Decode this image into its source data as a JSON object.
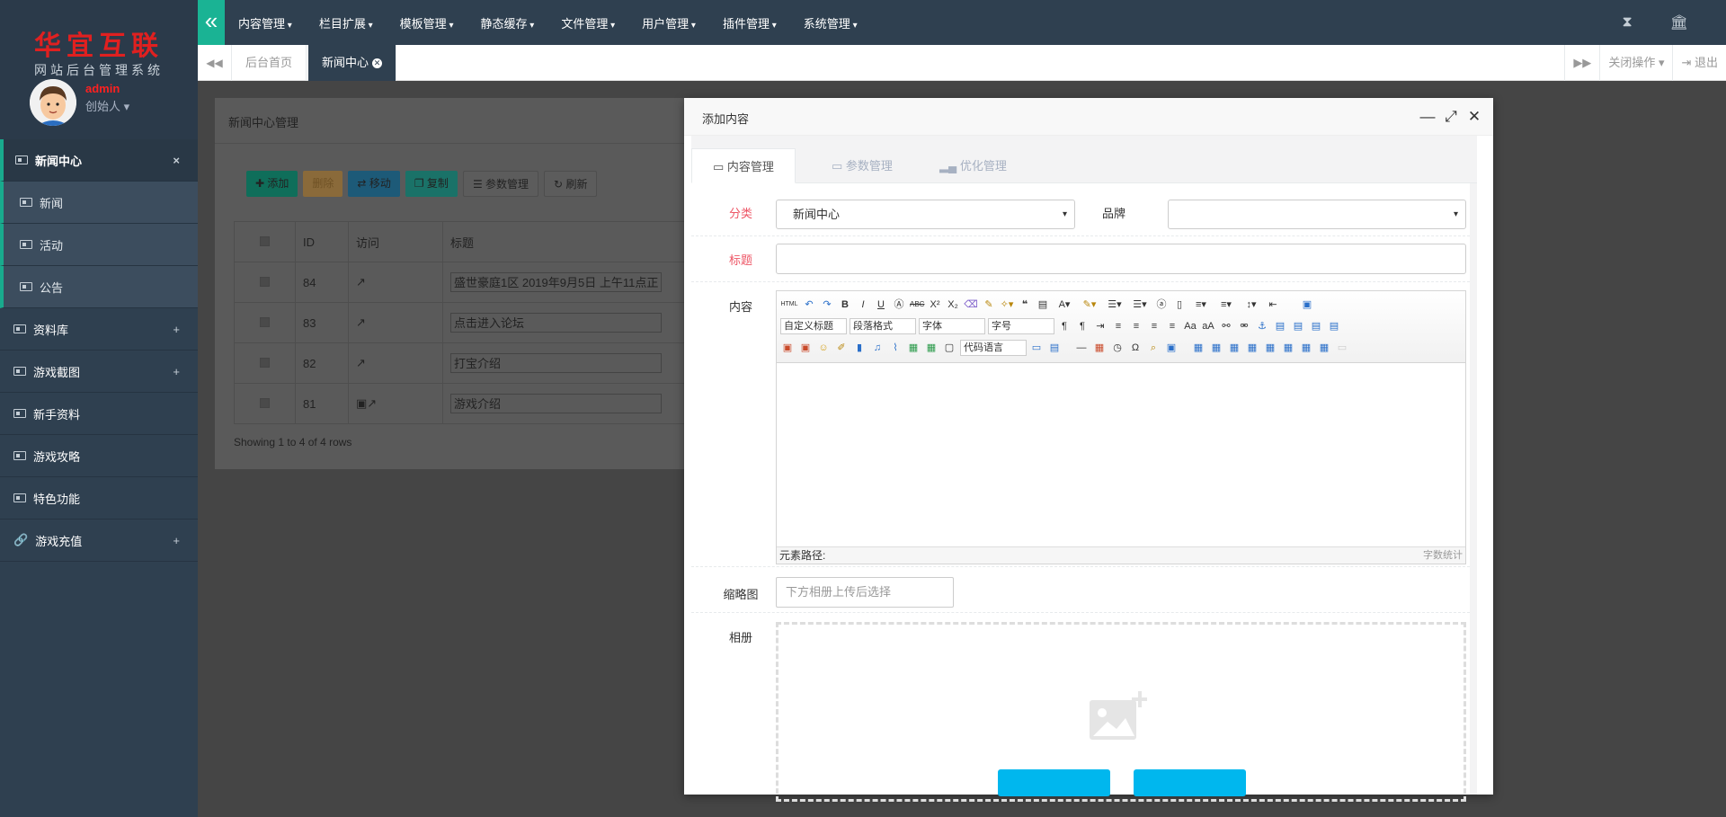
{
  "brand": {
    "title": "华宜互联",
    "subtitle": "网站后台管理系统"
  },
  "user": {
    "name": "admin",
    "role": "创始人"
  },
  "sidebar": {
    "items": [
      {
        "label": "新闻中心",
        "close": "×"
      },
      {
        "label": "新闻"
      },
      {
        "label": "活动"
      },
      {
        "label": "公告"
      },
      {
        "label": "资料库",
        "expand": "+"
      },
      {
        "label": "游戏截图",
        "expand": "+"
      },
      {
        "label": "新手资料"
      },
      {
        "label": "游戏攻略"
      },
      {
        "label": "特色功能"
      },
      {
        "label": "游戏充值",
        "expand": "+"
      }
    ]
  },
  "topnav": [
    "内容管理",
    "栏目扩展",
    "模板管理",
    "静态缓存",
    "文件管理",
    "用户管理",
    "插件管理",
    "系统管理"
  ],
  "tabs": {
    "home": "后台首页",
    "active": "新闻中心",
    "close_ops": "关闭操作",
    "logout": "退出"
  },
  "panel": {
    "title": "新闻中心管理",
    "buttons": [
      "添加",
      "删除",
      "移动",
      "复制",
      "参数管理",
      "刷新"
    ],
    "columns": [
      "ID",
      "访问",
      "标题"
    ],
    "rows": [
      {
        "id": "84",
        "title": "盛世豪庭1区  2019年9月5日 上午11点正"
      },
      {
        "id": "83",
        "title": "点击进入论坛"
      },
      {
        "id": "82",
        "title": "打宝介绍"
      },
      {
        "id": "81",
        "title": "游戏介绍"
      }
    ],
    "showing": "Showing 1 to 4 of 4 rows"
  },
  "modal": {
    "title": "添加内容",
    "tabs": [
      "内容管理",
      "参数管理",
      "优化管理"
    ],
    "fields": {
      "category_label": "分类",
      "category_value": "新闻中心",
      "brand_label": "品牌",
      "title_label": "标题",
      "content_label": "内容",
      "thumb_label": "缩略图",
      "thumb_placeholder": "下方相册上传后选择",
      "album_label": "相册"
    },
    "editor": {
      "selects": [
        "自定义标题",
        "段落格式",
        "字体",
        "字号",
        "代码语言"
      ],
      "path_label": "元素路径:",
      "word_count": "字数统计"
    }
  },
  "colors": {
    "accent": "#1ab394",
    "sidebar": "#2f4050",
    "required": "#ed5565",
    "upload": "#00b7ee"
  }
}
